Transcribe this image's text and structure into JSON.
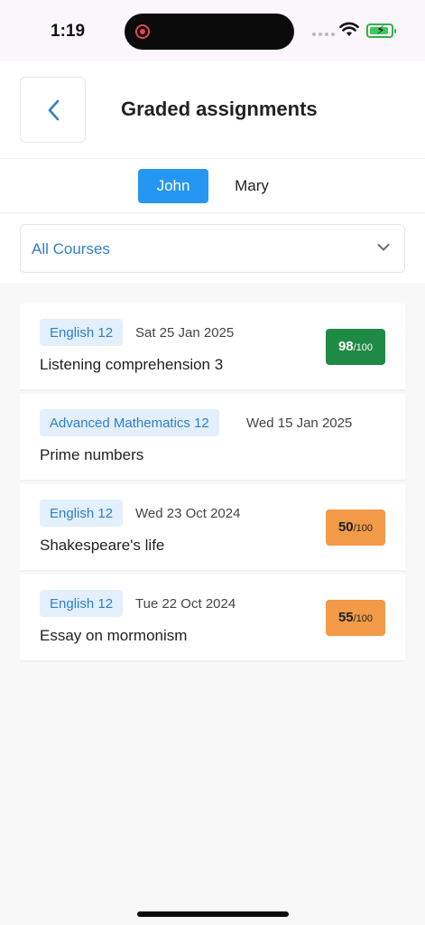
{
  "status_bar": {
    "time": "1:19",
    "icons": [
      "screen-recording-icon",
      "signal-icon",
      "wifi-icon",
      "battery-charging-icon"
    ]
  },
  "header": {
    "title": "Graded assignments",
    "back_icon": "chevron-left-icon"
  },
  "students": {
    "tabs": [
      "John",
      "Mary"
    ],
    "selected": "John"
  },
  "filter": {
    "course_value": "All Courses",
    "icon": "chevron-down-icon"
  },
  "assignments": [
    {
      "course": "English 12",
      "date": "Sat 25 Jan 2025",
      "title": "Listening comprehension 3",
      "score": "98",
      "total": "/100",
      "badge_color": "#1f8a45"
    },
    {
      "course": "Advanced Mathematics 12",
      "date": "Wed 15 Jan 2025",
      "title": "Prime numbers",
      "score": "",
      "total": ""
    },
    {
      "course": "English 12",
      "date": "Wed 23 Oct 2024",
      "title": "Shakespeare's life",
      "score": "50",
      "total": "/100",
      "badge_color": "#f29a48"
    },
    {
      "course": "English 12",
      "date": "Tue 22 Oct 2024",
      "title": "Essay on mormonism",
      "score": "55",
      "total": "/100",
      "badge_color": "#f29a48"
    }
  ],
  "colors": {
    "accent": "#2597f3",
    "link": "#2f7fc9",
    "tag_background": "#e3effb"
  }
}
